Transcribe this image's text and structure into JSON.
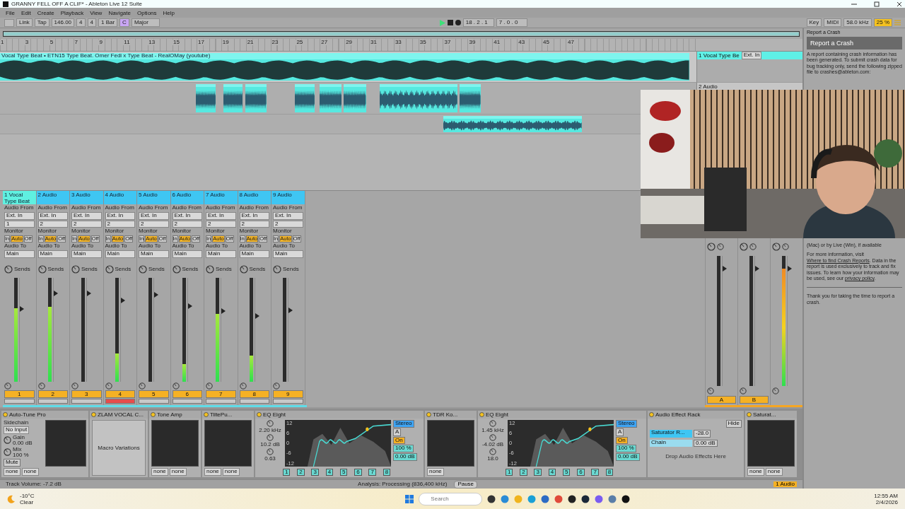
{
  "window": {
    "title": "GRANNY FELL OFF A CLIF* - Ableton Live 12 Suite"
  },
  "menu": [
    "File",
    "Edit",
    "Create",
    "Playback",
    "View",
    "Navigate",
    "Options",
    "Help"
  ],
  "control_bar": {
    "link": "Link",
    "tap": "Tap",
    "tempo": "146.00",
    "sig_num": "4",
    "sig_den": "4",
    "quantize": "1 Bar",
    "key": "C",
    "scale": "Major",
    "playing": true,
    "position": "18 . 2 . 1",
    "loop_length": "7 . 0 . 0",
    "key_map": "Key",
    "midi_map": "MIDI",
    "sample_rate": "58.0 kHz",
    "cpu": "25 %"
  },
  "ruler": [
    "1",
    "3",
    "5",
    "7",
    "9",
    "11",
    "13",
    "15",
    "17",
    "19",
    "21",
    "23",
    "25",
    "27",
    "29",
    "31",
    "33",
    "35",
    "37",
    "39",
    "41",
    "43",
    "45",
    "47"
  ],
  "tracks": [
    {
      "name": "1 Vocal Type Be",
      "input": "Ext. In",
      "selected": true,
      "clips": [
        {
          "kind": "audio",
          "title": "Vocal Type Beat • ETN15 Type Beat. Omer Fedi x Type Beat - RealOMay (youtube)"
        }
      ]
    },
    {
      "name": "2 Audio",
      "selected": false,
      "clips": [
        {
          "kind": "audio"
        },
        {
          "kind": "audio"
        },
        {
          "kind": "audio"
        },
        {
          "kind": "audio"
        },
        {
          "kind": "audio"
        },
        {
          "kind": "audio"
        },
        {
          "kind": "audio"
        },
        {
          "kind": "audio"
        }
      ]
    },
    {
      "selected": false,
      "clips": [
        {
          "kind": "audio"
        }
      ]
    }
  ],
  "mixer": {
    "channels": [
      {
        "name": "1 Vocal Type Beat",
        "selected": true,
        "from_label": "Audio From",
        "from": "Ext. In",
        "input": "1",
        "monitor_label": "Monitor",
        "monitor": [
          {
            "label": "In",
            "selected": false
          },
          {
            "label": "Auto",
            "selected": true
          },
          {
            "label": "Off",
            "selected": false
          }
        ],
        "to_label": "Audio To",
        "to": "Main",
        "sends": "Sends",
        "number": "1",
        "armed": false,
        "meter": {
          "level": 0.71
        },
        "fader": {
          "level": 0.7
        }
      },
      {
        "name": "2 Audio",
        "selected": false,
        "from_label": "Audio From",
        "from": "Ext. In",
        "input": "2",
        "monitor_label": "Monitor",
        "monitor": [
          {
            "label": "In",
            "selected": false
          },
          {
            "label": "Auto",
            "selected": true
          },
          {
            "label": "Off",
            "selected": false
          }
        ],
        "to_label": "Audio To",
        "to": "Main",
        "sends": "Sends",
        "number": "2",
        "armed": false,
        "meter": {
          "level": 0.72
        },
        "fader": {
          "level": 0.85
        }
      },
      {
        "name": "3 Audio",
        "selected": false,
        "from_label": "Audio From",
        "from": "Ext. In",
        "input": "2",
        "monitor_label": "Monitor",
        "monitor": [
          {
            "label": "In",
            "selected": false
          },
          {
            "label": "Auto",
            "selected": true
          },
          {
            "label": "Off",
            "selected": false
          }
        ],
        "to_label": "Audio To",
        "to": "Main",
        "sends": "Sends",
        "number": "3",
        "armed": false,
        "fader": {
          "level": 0.85
        }
      },
      {
        "name": "4 Audio",
        "selected": false,
        "from_label": "Audio From",
        "from": "Ext. In",
        "input": "2",
        "monitor_label": "Monitor",
        "monitor": [
          {
            "label": "In",
            "selected": false
          },
          {
            "label": "Auto",
            "selected": true
          },
          {
            "label": "Off",
            "selected": false
          }
        ],
        "to_label": "Audio To",
        "to": "Main",
        "sends": "Sends",
        "number": "4",
        "armed": true,
        "meter": {
          "level": 0.27
        },
        "fader": {
          "level": 0.78
        }
      },
      {
        "name": "5 Audio",
        "selected": false,
        "from_label": "Audio From",
        "from": "Ext. In",
        "input": "2",
        "monitor_label": "Monitor",
        "monitor": [
          {
            "label": "In",
            "selected": false
          },
          {
            "label": "Auto",
            "selected": true
          },
          {
            "label": "Off",
            "selected": false
          }
        ],
        "to_label": "Audio To",
        "to": "Main",
        "sends": "Sends",
        "number": "5",
        "armed": false,
        "fader": {
          "level": 0.84
        }
      },
      {
        "name": "6 Audio",
        "selected": false,
        "from_label": "Audio From",
        "from": "Ext. In",
        "input": "2",
        "monitor_label": "Monitor",
        "monitor": [
          {
            "label": "In",
            "selected": false
          },
          {
            "label": "Auto",
            "selected": true
          },
          {
            "label": "Off",
            "selected": false
          }
        ],
        "to_label": "Audio To",
        "to": "Main",
        "sends": "Sends",
        "number": "6",
        "armed": false,
        "meter": {
          "level": 0.17
        },
        "fader": {
          "level": 0.73
        }
      },
      {
        "name": "7 Audio",
        "selected": false,
        "from_label": "Audio From",
        "from": "Ext. In",
        "input": "2",
        "monitor_label": "Monitor",
        "monitor": [
          {
            "label": "In",
            "selected": false
          },
          {
            "label": "Auto",
            "selected": true
          },
          {
            "label": "Off",
            "selected": false
          }
        ],
        "to_label": "Audio To",
        "to": "Main",
        "sends": "Sends",
        "number": "7",
        "armed": false,
        "meter": {
          "level": 0.65
        },
        "fader": {
          "level": 0.68
        }
      },
      {
        "name": "8 Audio",
        "selected": false,
        "from_label": "Audio From",
        "from": "Ext. In",
        "input": "2",
        "monitor_label": "Monitor",
        "monitor": [
          {
            "label": "In",
            "selected": false
          },
          {
            "label": "Auto",
            "selected": true
          },
          {
            "label": "Off",
            "selected": false
          }
        ],
        "to_label": "Audio To",
        "to": "Main",
        "sends": "Sends",
        "number": "8",
        "armed": false,
        "meter": {
          "level": 0.25
        },
        "fader": {
          "level": 0.63
        }
      },
      {
        "name": "9 Audio",
        "selected": false,
        "from_label": "Audio From",
        "from": "Ext. In",
        "input": "2",
        "monitor_label": "Monitor",
        "monitor": [
          {
            "label": "In",
            "selected": false
          },
          {
            "label": "Auto",
            "selected": true
          },
          {
            "label": "Off",
            "selected": false
          }
        ],
        "to_label": "Audio To",
        "to": "Main",
        "sends": "Sends",
        "number": "9",
        "armed": false,
        "fader": {
          "level": 0.69
        }
      }
    ],
    "returns": [
      {
        "label": "A",
        "fader": {
          "level": 0.9
        }
      },
      {
        "label": "B",
        "fader": {
          "level": 0.9
        }
      },
      {
        "meter": {
          "level": 0.9
        },
        "fader": {
          "level": 0.9
        }
      }
    ]
  },
  "devices": [
    {
      "kind": "display",
      "name": "Auto-Tune Pro",
      "side": {
        "sidechain": "Sidechain",
        "input": "No Input",
        "gain_label": "Gain",
        "gain": "0.00 dB",
        "mix_label": "Mix",
        "mix": "100 %",
        "mute": "Mute"
      },
      "selects": [
        "none",
        "none"
      ]
    },
    {
      "kind": "macro",
      "name": "ZLAM VOCAL C...",
      "text": "Macro Variations"
    },
    {
      "kind": "display",
      "name": "Tone Amp",
      "selects": [
        "none",
        "none"
      ]
    },
    {
      "kind": "display",
      "name": "TiltePu...",
      "selects": [
        "none",
        "none"
      ]
    },
    {
      "kind": "eq",
      "name": "EQ Eight",
      "freq": "2.20 kHz",
      "gain": "10.2 dB",
      "q": "0.63",
      "mode": "Stereo",
      "edit": "A",
      "adapt": "On",
      "scale": "100 %",
      "out_gain": "0.00 dB",
      "ticks": [
        "12",
        "6",
        "0",
        "-6",
        "-12"
      ],
      "bands": [
        "1",
        "2",
        "3",
        "4",
        "5",
        "6",
        "7",
        "8"
      ]
    },
    {
      "kind": "display",
      "name": "TDR Ko...",
      "selects": [
        "none"
      ]
    },
    {
      "kind": "eq",
      "name": "EQ Eight",
      "freq": "1.45 kHz",
      "gain": "-4.02 dB",
      "q": "18.0",
      "mode": "Stereo",
      "edit": "A",
      "adapt": "On",
      "scale": "100 %",
      "out_gain": "0.00 dB",
      "ticks": [
        "12",
        "6",
        "0",
        "-6",
        "-12"
      ],
      "bands": [
        "1",
        "2",
        "3",
        "4",
        "5",
        "6",
        "7",
        "8"
      ]
    },
    {
      "kind": "rack",
      "name": "Audio Effect Rack",
      "hide": "Hide",
      "chains": [
        {
          "name": "Saturator R...",
          "volume": "-28.0",
          "selected": true
        },
        {
          "name": "Chain",
          "volume": "0.00 dB",
          "selected": false
        }
      ],
      "drop": "Drop Audio Effects Here"
    },
    {
      "kind": "display",
      "name": "Saturat...",
      "selects": [
        "none",
        "none"
      ]
    }
  ],
  "status_bar": {
    "info": "Track Volume: -7.2 dB",
    "analysis": "Analysis: Processing (836,400 kHz)",
    "button": "Pause",
    "track": "1 Audio"
  },
  "crash_panel": {
    "title": "Report a Crash",
    "heading": "Report a Crash",
    "intro": "A report containing crash information has been generated. To submit crash data for bug tracking only, send the following zipped file to crashes@ableton.com:",
    "visible_line": "(Mac) or by Live (Win), if available",
    "more_before": "For more information, visit ",
    "more_link": "Where to find Crash Reports",
    "more_after": ". Data in the report is used exclusively to track and fix issues. To learn how your information may be used, see our ",
    "privacy_link": "privacy policy",
    "more_end": ".",
    "thanks": "Thank you for taking the time to report a crash."
  },
  "webcam": {
    "kind": "picture"
  },
  "taskbar": {
    "temperature": "-10°C",
    "weather": "Clear",
    "search": {
      "placeholder": "Search"
    },
    "time": "12:55 AM",
    "date": "2/4/2026"
  }
}
